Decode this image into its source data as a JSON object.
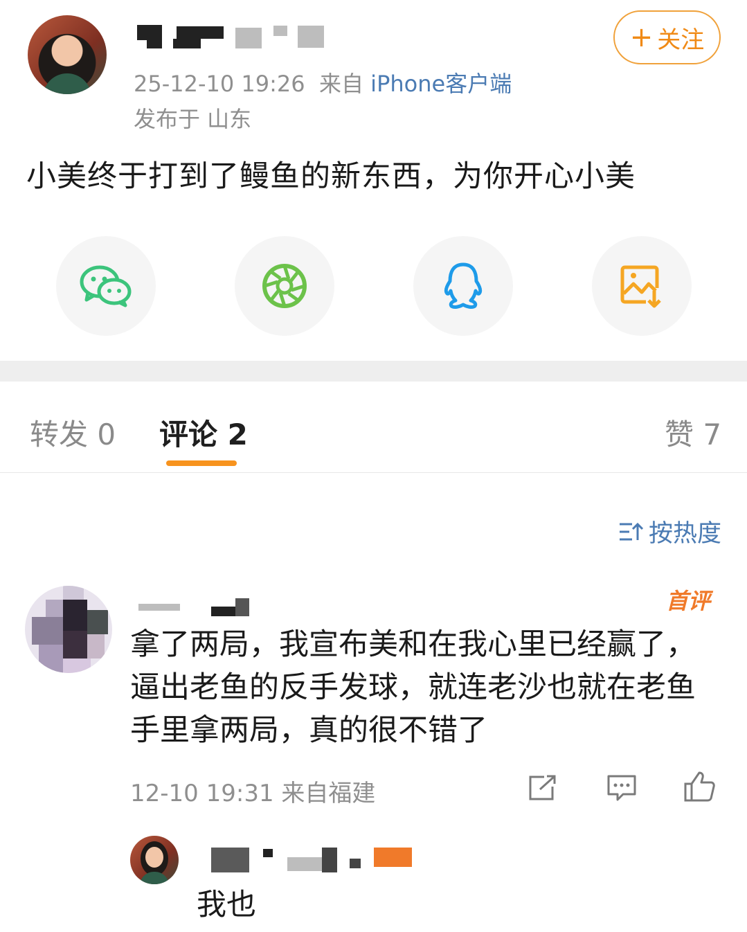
{
  "post": {
    "timestamp": "25-12-10 19:26",
    "from_label": "来自",
    "source": "iPhone客户端",
    "location": "发布于 山东",
    "text": "小美终于打到了鳗鱼的新东西，为你开心小美",
    "follow_label": "关注"
  },
  "share": {
    "items": [
      {
        "icon": "wechat-icon",
        "color": "#3cc47c"
      },
      {
        "icon": "moments-icon",
        "color": "#6cc24a"
      },
      {
        "icon": "qq-icon",
        "color": "#1e9be9"
      },
      {
        "icon": "save-image-icon",
        "color": "#f5a623"
      }
    ]
  },
  "tabs": {
    "repost": "转发 0",
    "comments": "评论 2",
    "likes": "赞 7"
  },
  "sort_label": "按热度",
  "comments": [
    {
      "badge": "首评",
      "text": "拿了两局，我宣布美和在我心里已经赢了，逼出老鱼的反手发球，就连老沙也就在老鱼手里拿两局，真的很不错了",
      "meta": "12-10 19:31  来自福建",
      "reply": {
        "text": "我也"
      }
    }
  ],
  "colors": {
    "accent": "#f7931e",
    "link": "#4b7bb3"
  }
}
